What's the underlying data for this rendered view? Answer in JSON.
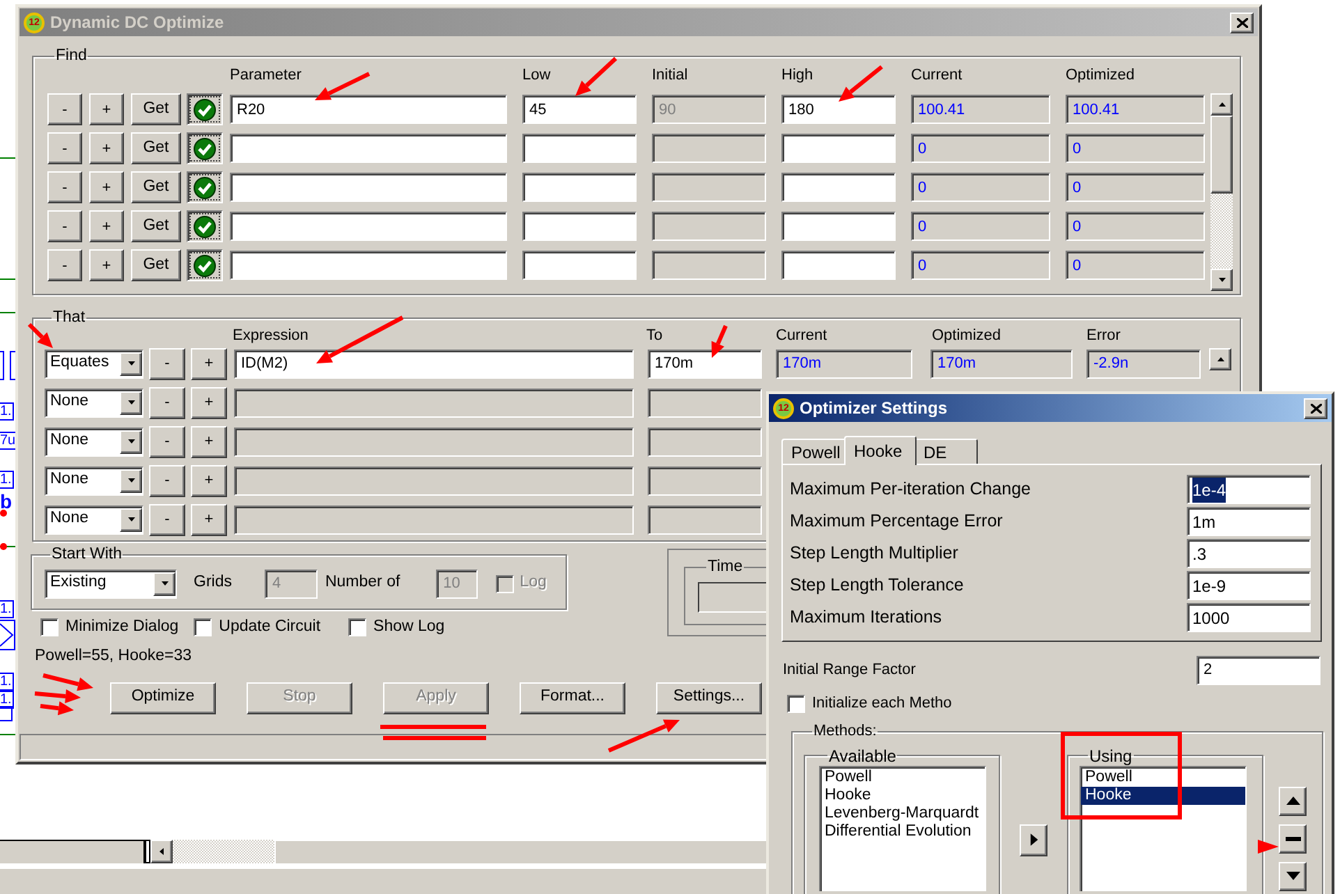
{
  "schematic": {
    "labels": [
      "1.",
      "7u",
      "1.",
      "b",
      "1.",
      "1.",
      "1."
    ]
  },
  "main_window": {
    "icon_text": "12",
    "title": "Dynamic DC Optimize",
    "active": false
  },
  "find": {
    "title": "Find",
    "columns": [
      "Parameter",
      "Low",
      "Initial",
      "High",
      "Current",
      "Optimized"
    ],
    "rows": [
      {
        "buttons": [
          "-",
          "+",
          "Get"
        ],
        "checked": true,
        "parameter": "R20",
        "low": "45",
        "initial": "90",
        "high": "180",
        "current": "100.41",
        "optimized": "100.41"
      },
      {
        "buttons": [
          "-",
          "+",
          "Get"
        ],
        "checked": true,
        "current": "0",
        "optimized": "0"
      },
      {
        "buttons": [
          "-",
          "+",
          "Get"
        ],
        "checked": true,
        "current": "0",
        "optimized": "0"
      },
      {
        "buttons": [
          "-",
          "+",
          "Get"
        ],
        "checked": true,
        "current": "0",
        "optimized": "0"
      },
      {
        "buttons": [
          "-",
          "+",
          "Get"
        ],
        "checked": true,
        "current": "0",
        "optimized": "0"
      }
    ]
  },
  "that": {
    "title": "That",
    "columns": [
      "Expression",
      "To",
      "Current",
      "Optimized",
      "Error"
    ],
    "rows": [
      {
        "condition": "Equates",
        "buttons": [
          "-",
          "+"
        ],
        "disabled": false,
        "expression": "ID(M2)",
        "to": "170m",
        "current": "170m",
        "optimized": "170m",
        "error": "-2.9n"
      },
      {
        "condition": "None",
        "buttons": [
          "-",
          "+"
        ],
        "disabled": true
      },
      {
        "condition": "None",
        "buttons": [
          "-",
          "+"
        ],
        "disabled": true
      },
      {
        "condition": "None",
        "buttons": [
          "-",
          "+"
        ],
        "disabled": true
      },
      {
        "condition": "None",
        "buttons": [
          "-",
          "+"
        ],
        "disabled": true
      }
    ]
  },
  "start_with": {
    "title": "Start With",
    "mode": "Existing",
    "grids_label": "Grids",
    "grids": "4",
    "number_label": "Number of",
    "number": "10",
    "log": {
      "label": "Log",
      "checked": false,
      "disabled": true
    }
  },
  "time": {
    "title": "Time"
  },
  "options": [
    {
      "label": "Minimize Dialog",
      "checked": false
    },
    {
      "label": "Update Circuit",
      "checked": false
    },
    {
      "label": "Show Log",
      "checked": false
    }
  ],
  "summary": "Powell=55, Hooke=33",
  "actions": [
    {
      "label": "Optimize",
      "disabled": false
    },
    {
      "label": "Stop",
      "disabled": true
    },
    {
      "label": "Apply",
      "disabled": true
    },
    {
      "label": "Format...",
      "disabled": false
    },
    {
      "label": "Settings...",
      "disabled": false
    }
  ],
  "settings_window": {
    "icon_text": "12",
    "title": "Optimizer Settings",
    "active": true,
    "tabs": [
      {
        "label": "Powell",
        "selected": false
      },
      {
        "label": "Hooke",
        "selected": true
      },
      {
        "label": "DE",
        "selected": false
      }
    ],
    "fields": [
      {
        "label": "Maximum Per-iteration Change",
        "value": "1e-4",
        "text_selected": true
      },
      {
        "label": "Maximum Percentage Error",
        "value": "1m",
        "text_selected": false
      },
      {
        "label": "Step Length Multiplier",
        "value": ".3",
        "text_selected": false
      },
      {
        "label": "Step Length Tolerance",
        "value": "1e-9",
        "text_selected": false
      },
      {
        "label": "Maximum Iterations",
        "value": "1000",
        "text_selected": false
      }
    ],
    "initial_range": {
      "label": "Initial Range Factor",
      "value": "2"
    },
    "initialize_each": {
      "label": "Initialize each Metho",
      "checked": false
    },
    "methods": {
      "title": "Methods:",
      "available": {
        "title": "Available",
        "items": [
          "Powell",
          "Hooke",
          "Levenberg-Marquardt",
          "Differential Evolution"
        ]
      },
      "using": {
        "title": "Using",
        "items": [
          {
            "label": "Powell",
            "selected": false
          },
          {
            "label": "Hooke",
            "selected": true
          }
        ]
      }
    }
  }
}
